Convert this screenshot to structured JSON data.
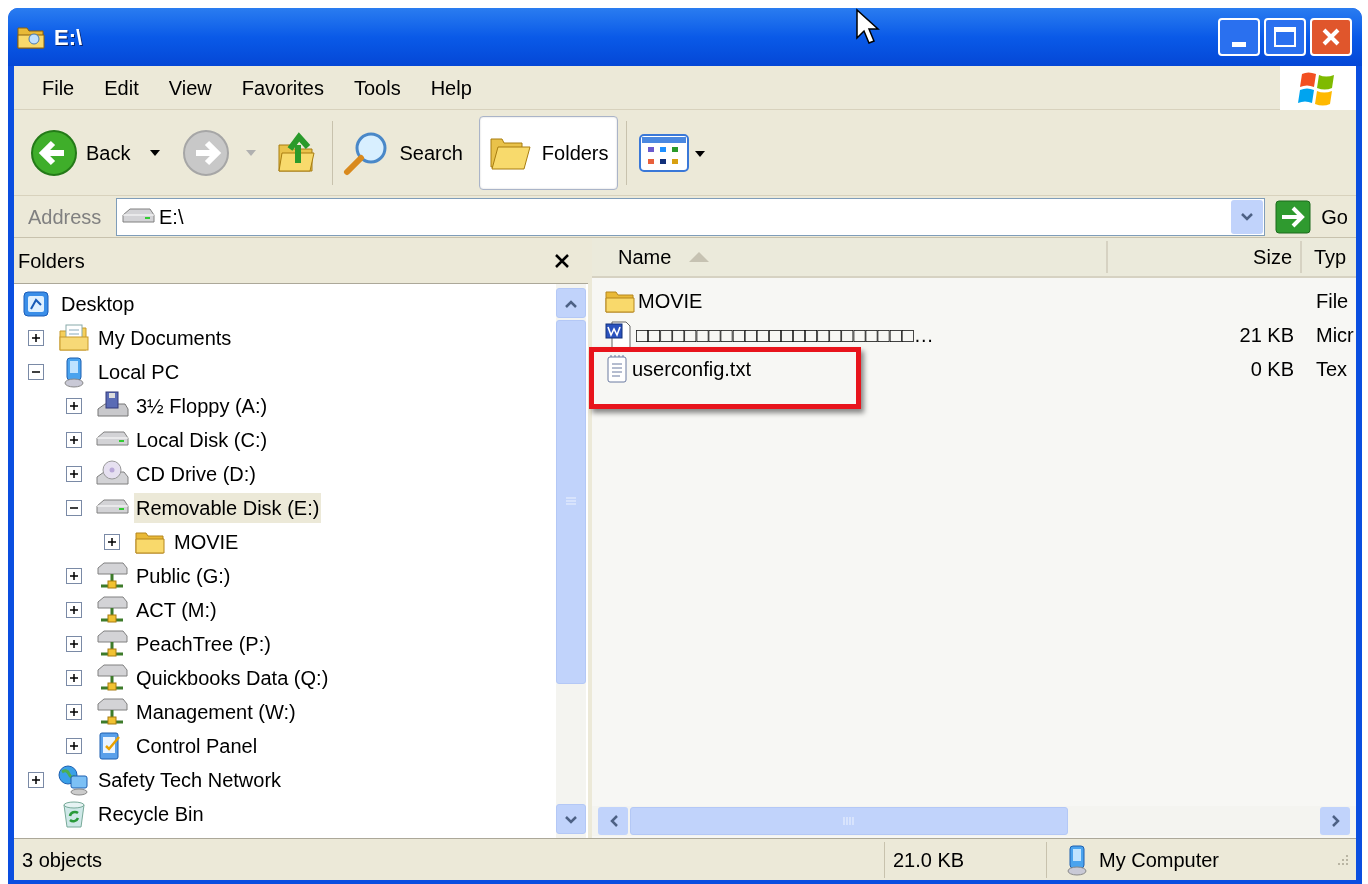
{
  "window": {
    "title": "E:\\"
  },
  "menu": [
    "File",
    "Edit",
    "View",
    "Favorites",
    "Tools",
    "Help"
  ],
  "toolbar": {
    "back": "Back",
    "search": "Search",
    "folders": {
      "label": "Folders",
      "selected": true
    }
  },
  "address": {
    "label": "Address",
    "value": "E:\\",
    "go": "Go"
  },
  "folders_pane": {
    "title": "Folders",
    "tree": [
      {
        "kind": "desktop",
        "label": "Desktop",
        "selected": false,
        "children": [
          {
            "kind": "documents",
            "label": "My Documents",
            "expanded": false,
            "selected": false
          },
          {
            "kind": "computer",
            "label": "Local PC",
            "expanded": true,
            "selected": false,
            "children": [
              {
                "kind": "floppy",
                "label": "3½ Floppy (A:)",
                "expanded": false,
                "selected": false
              },
              {
                "kind": "disk",
                "label": "Local Disk (C:)",
                "expanded": false,
                "selected": false
              },
              {
                "kind": "cd",
                "label": "CD Drive (D:)",
                "expanded": false,
                "selected": false
              },
              {
                "kind": "disk",
                "label": "Removable Disk (E:)",
                "expanded": true,
                "selected": true,
                "children": [
                  {
                    "kind": "folder",
                    "label": "MOVIE",
                    "expanded": false,
                    "selected": false
                  }
                ]
              },
              {
                "kind": "network-drive",
                "label": "Public (G:)",
                "expanded": false,
                "selected": false
              },
              {
                "kind": "network-drive",
                "label": "ACT (M:)",
                "expanded": false,
                "selected": false
              },
              {
                "kind": "network-drive",
                "label": "PeachTree (P:)",
                "expanded": false,
                "selected": false
              },
              {
                "kind": "network-drive",
                "label": "Quickbooks Data (Q:)",
                "expanded": false,
                "selected": false
              },
              {
                "kind": "network-drive",
                "label": "Management (W:)",
                "expanded": false,
                "selected": false
              },
              {
                "kind": "control-panel",
                "label": "Control Panel",
                "expanded": false,
                "selected": false
              }
            ]
          },
          {
            "kind": "network",
            "label": "Safety Tech Network",
            "expanded": false,
            "selected": false
          },
          {
            "kind": "recycle",
            "label": "Recycle Bin",
            "selected": false
          }
        ]
      }
    ]
  },
  "file_list": {
    "columns": [
      {
        "label": "Name",
        "sorted": true
      },
      {
        "label": "Size"
      },
      {
        "label": "Typ"
      }
    ],
    "rows": [
      {
        "kind": "folder",
        "name": "MOVIE",
        "type": "File",
        "highlighted": false
      },
      {
        "kind": "word",
        "name": "□□□□□□□□□□□□□□□□□□□□□□□…",
        "size": "21 KB",
        "type": "Micr",
        "highlighted": false
      },
      {
        "kind": "text",
        "name": "userconfig.txt",
        "size": "0 KB",
        "type": "Tex",
        "highlighted": true
      }
    ]
  },
  "status_bar": {
    "count": "3 objects",
    "size": "21.0 KB",
    "zone": "My Computer"
  }
}
